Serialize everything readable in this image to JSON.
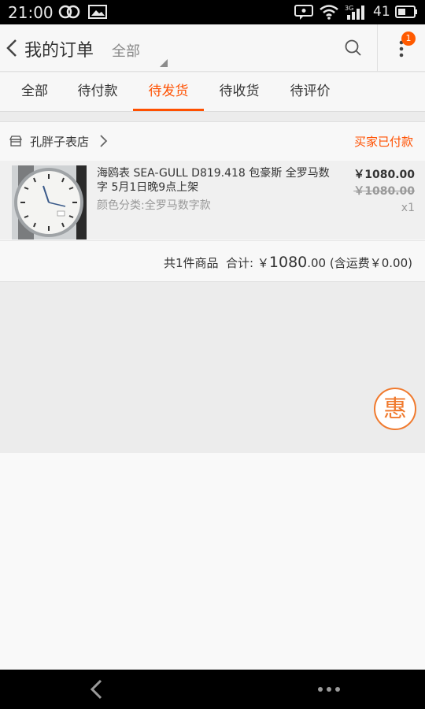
{
  "status_bar": {
    "time": "21:00",
    "battery_level": "41",
    "network_label": "3G"
  },
  "header": {
    "title": "我的订单",
    "filter_label": "全部",
    "notification_count": "1"
  },
  "tabs": [
    {
      "label": "全部",
      "active": false
    },
    {
      "label": "待付款",
      "active": false
    },
    {
      "label": "待发货",
      "active": true
    },
    {
      "label": "待收货",
      "active": false
    },
    {
      "label": "待评价",
      "active": false
    }
  ],
  "order": {
    "shop_name": "孔胖子表店",
    "status": "买家已付款",
    "item": {
      "title": "海鸥表 SEA-GULL D819.418 包豪斯 全罗马数字 5月1日晚9点上架",
      "sku": "颜色分类:全罗马数字款",
      "price": "￥1080.00",
      "original_price": "￥1080.00",
      "quantity": "x1"
    },
    "summary": {
      "count_text": "共1件商品",
      "total_label": "合计:",
      "currency": "￥",
      "total_int": "1080",
      "total_dec": ".00",
      "shipping_note": "(含运费￥0.00)"
    }
  },
  "floating": {
    "promo_glyph": "惠"
  },
  "colors": {
    "accent": "#ff5000",
    "promo": "#f07a2e"
  }
}
